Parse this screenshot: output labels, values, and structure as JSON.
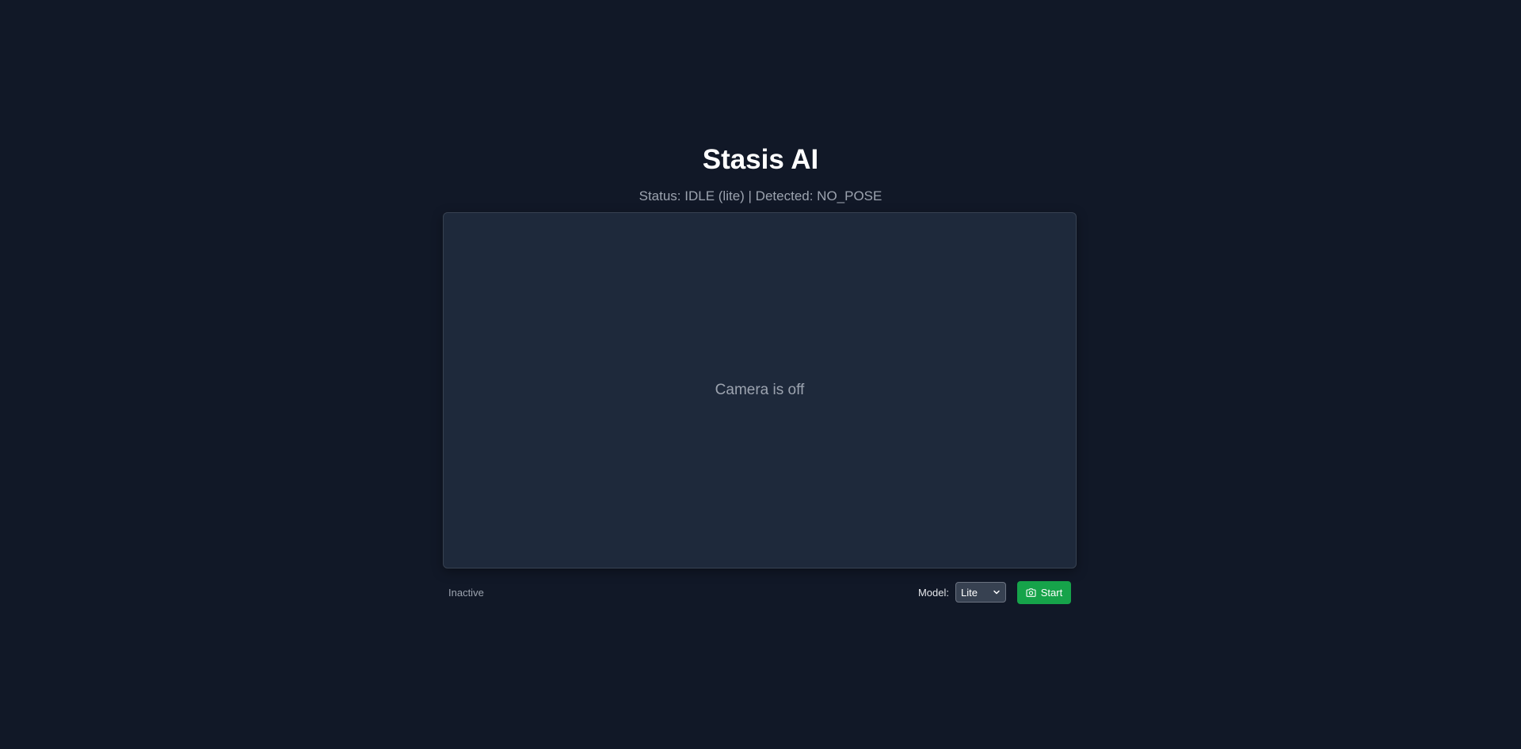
{
  "app": {
    "title": "Stasis AI",
    "status_text": "Status: IDLE (lite) | Detected: NO_POSE"
  },
  "camera": {
    "placeholder": "Camera is off"
  },
  "footer": {
    "state_text": "Inactive",
    "model_label": "Model:",
    "model_selected": "Lite",
    "start_label": "Start"
  },
  "icons": {
    "select_chevron": "chevron-down-icon",
    "start_button": "camera-icon"
  },
  "colors": {
    "background": "#111827",
    "panel": "#1e293b",
    "accent_green": "#16a34a"
  }
}
